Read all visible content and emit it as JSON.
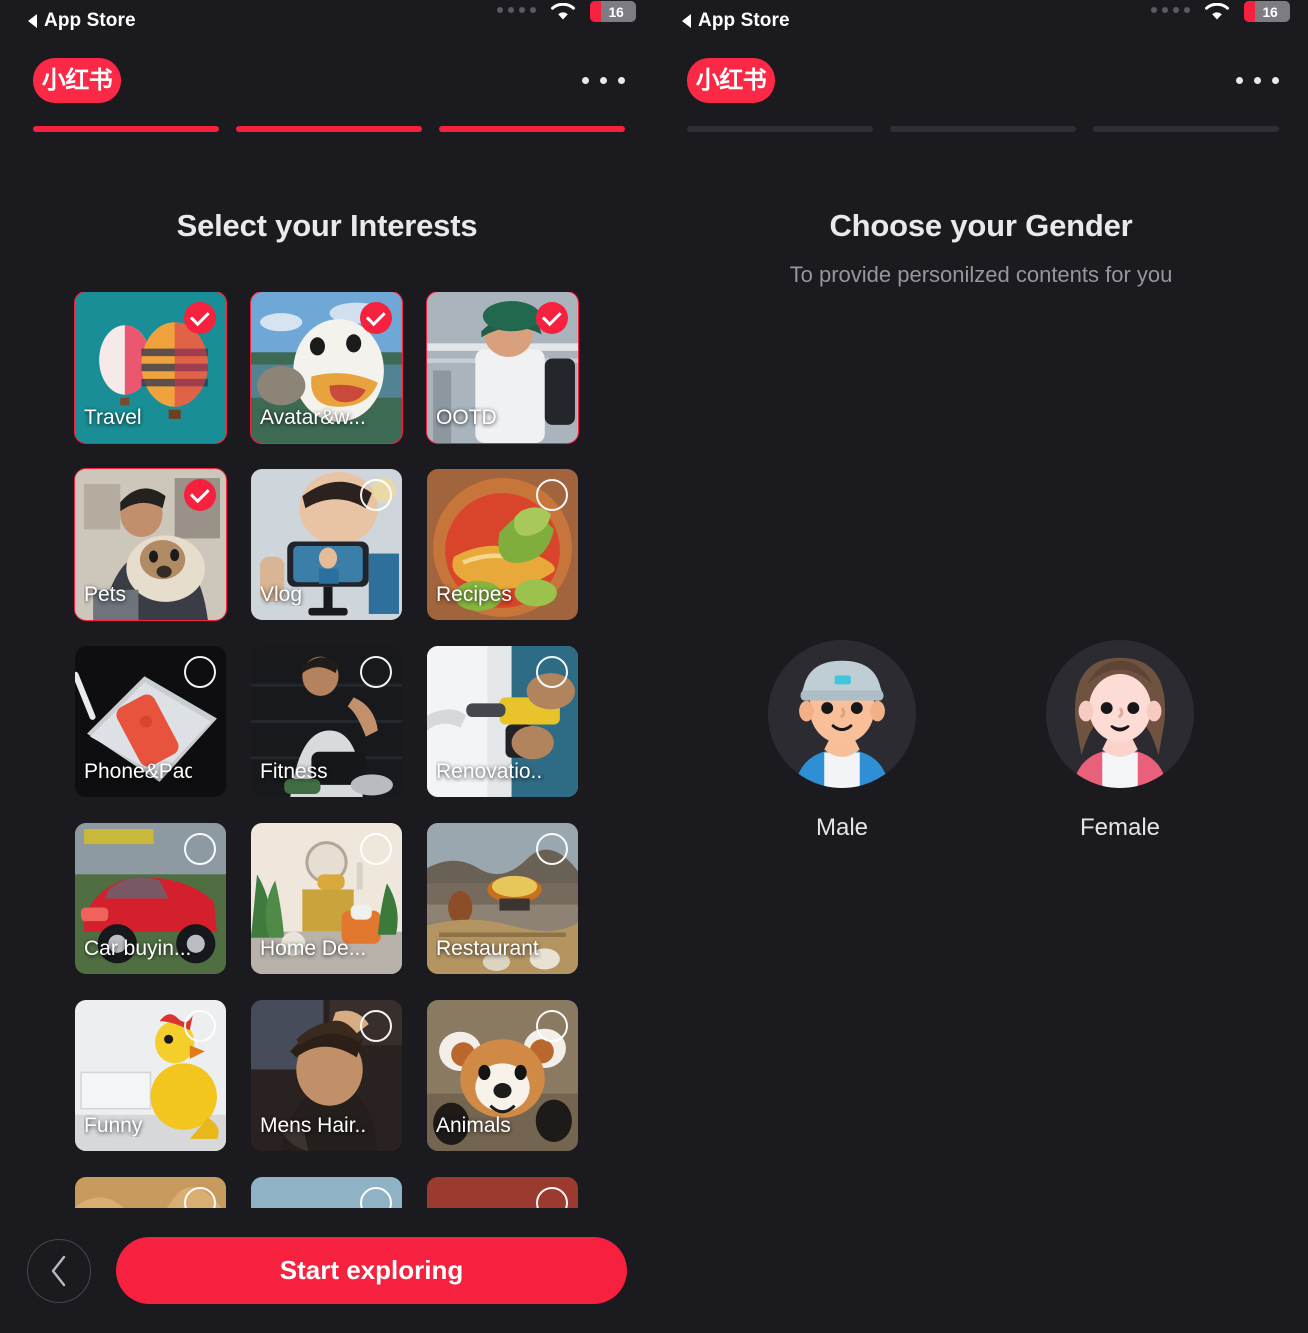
{
  "statusbar": {
    "battery_level": "16",
    "wifi_icon": "wifi-icon",
    "signal_dots_icon": "signal-dots-icon"
  },
  "nav": {
    "back_to_app_label": "App Store",
    "back_triangle_icon": "triangle-left-icon"
  },
  "brand": {
    "logo_text": "小红书",
    "logo_color": "#fb2846",
    "more_icon": "more-horizontal-icon"
  },
  "accent": {
    "primary": "#f5213f",
    "bar_inactive": "#2e2e34",
    "bg": "#1a1a1f"
  },
  "left_screen": {
    "title": "Select your Interests",
    "progress": [
      {
        "state": "active"
      },
      {
        "state": "active"
      },
      {
        "state": "active"
      }
    ],
    "interests": [
      {
        "label": "Travel",
        "selected": true,
        "art": "hot-air-balloons"
      },
      {
        "label": "Avatar&w...",
        "selected": true,
        "art": "duck"
      },
      {
        "label": "OOTD",
        "selected": true,
        "art": "outfit-man"
      },
      {
        "label": "Pets",
        "selected": true,
        "art": "man-with-dog"
      },
      {
        "label": "Vlog",
        "selected": false,
        "art": "phone-tripod"
      },
      {
        "label": "Recipes",
        "selected": false,
        "art": "noodle-bowl"
      },
      {
        "label": "Phone&Pad",
        "selected": false,
        "art": "phone-tablet"
      },
      {
        "label": "Fitness",
        "selected": false,
        "art": "man-exercising"
      },
      {
        "label": "Renovatio...",
        "selected": false,
        "art": "power-drill"
      },
      {
        "label": "Car buyin...",
        "selected": false,
        "art": "red-sports-car"
      },
      {
        "label": "Home De...",
        "selected": false,
        "art": "living-room"
      },
      {
        "label": "Restaurant",
        "selected": false,
        "art": "hotpot-rooftop"
      },
      {
        "label": "Funny",
        "selected": false,
        "art": "rubber-chicken"
      },
      {
        "label": "Mens Hair...",
        "selected": false,
        "art": "haircut"
      },
      {
        "label": "Animals",
        "selected": false,
        "art": "red-panda"
      },
      {
        "label": "",
        "selected": false,
        "art": "fabric-folds"
      },
      {
        "label": "",
        "selected": false,
        "art": "sky-portrait"
      },
      {
        "label": "",
        "selected": false,
        "art": "red-poster"
      }
    ],
    "bottom": {
      "back_icon": "chevron-left-icon",
      "cta_label": "Start exploring"
    }
  },
  "right_screen": {
    "title": "Choose your Gender",
    "subtitle": "To provide personilzed contents for you",
    "progress": [
      {
        "state": "inactive"
      },
      {
        "state": "inactive"
      },
      {
        "state": "inactive"
      }
    ],
    "genders": [
      {
        "label": "Male",
        "avatar": "male-avatar-icon"
      },
      {
        "label": "Female",
        "avatar": "female-avatar-icon"
      }
    ]
  }
}
